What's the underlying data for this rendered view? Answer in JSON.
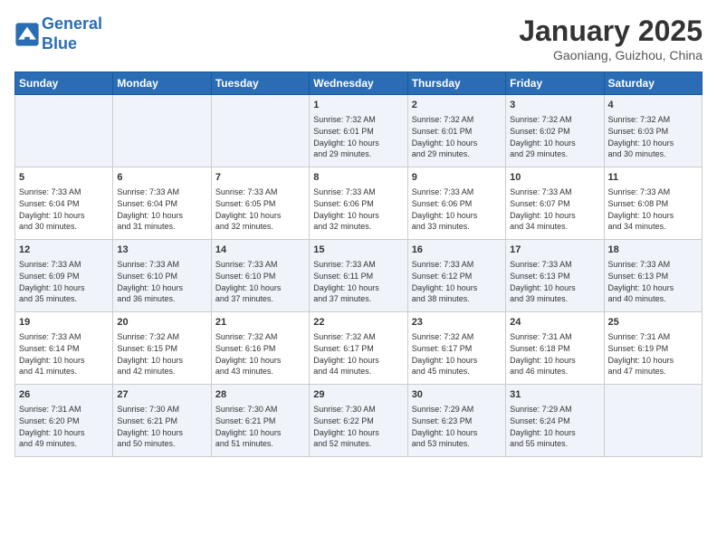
{
  "header": {
    "logo_line1": "General",
    "logo_line2": "Blue",
    "month_title": "January 2025",
    "location": "Gaoniang, Guizhou, China"
  },
  "days_of_week": [
    "Sunday",
    "Monday",
    "Tuesday",
    "Wednesday",
    "Thursday",
    "Friday",
    "Saturday"
  ],
  "weeks": [
    [
      {
        "day": "",
        "info": ""
      },
      {
        "day": "",
        "info": ""
      },
      {
        "day": "",
        "info": ""
      },
      {
        "day": "1",
        "info": "Sunrise: 7:32 AM\nSunset: 6:01 PM\nDaylight: 10 hours\nand 29 minutes."
      },
      {
        "day": "2",
        "info": "Sunrise: 7:32 AM\nSunset: 6:01 PM\nDaylight: 10 hours\nand 29 minutes."
      },
      {
        "day": "3",
        "info": "Sunrise: 7:32 AM\nSunset: 6:02 PM\nDaylight: 10 hours\nand 29 minutes."
      },
      {
        "day": "4",
        "info": "Sunrise: 7:32 AM\nSunset: 6:03 PM\nDaylight: 10 hours\nand 30 minutes."
      }
    ],
    [
      {
        "day": "5",
        "info": "Sunrise: 7:33 AM\nSunset: 6:04 PM\nDaylight: 10 hours\nand 30 minutes."
      },
      {
        "day": "6",
        "info": "Sunrise: 7:33 AM\nSunset: 6:04 PM\nDaylight: 10 hours\nand 31 minutes."
      },
      {
        "day": "7",
        "info": "Sunrise: 7:33 AM\nSunset: 6:05 PM\nDaylight: 10 hours\nand 32 minutes."
      },
      {
        "day": "8",
        "info": "Sunrise: 7:33 AM\nSunset: 6:06 PM\nDaylight: 10 hours\nand 32 minutes."
      },
      {
        "day": "9",
        "info": "Sunrise: 7:33 AM\nSunset: 6:06 PM\nDaylight: 10 hours\nand 33 minutes."
      },
      {
        "day": "10",
        "info": "Sunrise: 7:33 AM\nSunset: 6:07 PM\nDaylight: 10 hours\nand 34 minutes."
      },
      {
        "day": "11",
        "info": "Sunrise: 7:33 AM\nSunset: 6:08 PM\nDaylight: 10 hours\nand 34 minutes."
      }
    ],
    [
      {
        "day": "12",
        "info": "Sunrise: 7:33 AM\nSunset: 6:09 PM\nDaylight: 10 hours\nand 35 minutes."
      },
      {
        "day": "13",
        "info": "Sunrise: 7:33 AM\nSunset: 6:10 PM\nDaylight: 10 hours\nand 36 minutes."
      },
      {
        "day": "14",
        "info": "Sunrise: 7:33 AM\nSunset: 6:10 PM\nDaylight: 10 hours\nand 37 minutes."
      },
      {
        "day": "15",
        "info": "Sunrise: 7:33 AM\nSunset: 6:11 PM\nDaylight: 10 hours\nand 37 minutes."
      },
      {
        "day": "16",
        "info": "Sunrise: 7:33 AM\nSunset: 6:12 PM\nDaylight: 10 hours\nand 38 minutes."
      },
      {
        "day": "17",
        "info": "Sunrise: 7:33 AM\nSunset: 6:13 PM\nDaylight: 10 hours\nand 39 minutes."
      },
      {
        "day": "18",
        "info": "Sunrise: 7:33 AM\nSunset: 6:13 PM\nDaylight: 10 hours\nand 40 minutes."
      }
    ],
    [
      {
        "day": "19",
        "info": "Sunrise: 7:33 AM\nSunset: 6:14 PM\nDaylight: 10 hours\nand 41 minutes."
      },
      {
        "day": "20",
        "info": "Sunrise: 7:32 AM\nSunset: 6:15 PM\nDaylight: 10 hours\nand 42 minutes."
      },
      {
        "day": "21",
        "info": "Sunrise: 7:32 AM\nSunset: 6:16 PM\nDaylight: 10 hours\nand 43 minutes."
      },
      {
        "day": "22",
        "info": "Sunrise: 7:32 AM\nSunset: 6:17 PM\nDaylight: 10 hours\nand 44 minutes."
      },
      {
        "day": "23",
        "info": "Sunrise: 7:32 AM\nSunset: 6:17 PM\nDaylight: 10 hours\nand 45 minutes."
      },
      {
        "day": "24",
        "info": "Sunrise: 7:31 AM\nSunset: 6:18 PM\nDaylight: 10 hours\nand 46 minutes."
      },
      {
        "day": "25",
        "info": "Sunrise: 7:31 AM\nSunset: 6:19 PM\nDaylight: 10 hours\nand 47 minutes."
      }
    ],
    [
      {
        "day": "26",
        "info": "Sunrise: 7:31 AM\nSunset: 6:20 PM\nDaylight: 10 hours\nand 49 minutes."
      },
      {
        "day": "27",
        "info": "Sunrise: 7:30 AM\nSunset: 6:21 PM\nDaylight: 10 hours\nand 50 minutes."
      },
      {
        "day": "28",
        "info": "Sunrise: 7:30 AM\nSunset: 6:21 PM\nDaylight: 10 hours\nand 51 minutes."
      },
      {
        "day": "29",
        "info": "Sunrise: 7:30 AM\nSunset: 6:22 PM\nDaylight: 10 hours\nand 52 minutes."
      },
      {
        "day": "30",
        "info": "Sunrise: 7:29 AM\nSunset: 6:23 PM\nDaylight: 10 hours\nand 53 minutes."
      },
      {
        "day": "31",
        "info": "Sunrise: 7:29 AM\nSunset: 6:24 PM\nDaylight: 10 hours\nand 55 minutes."
      },
      {
        "day": "",
        "info": ""
      }
    ]
  ]
}
